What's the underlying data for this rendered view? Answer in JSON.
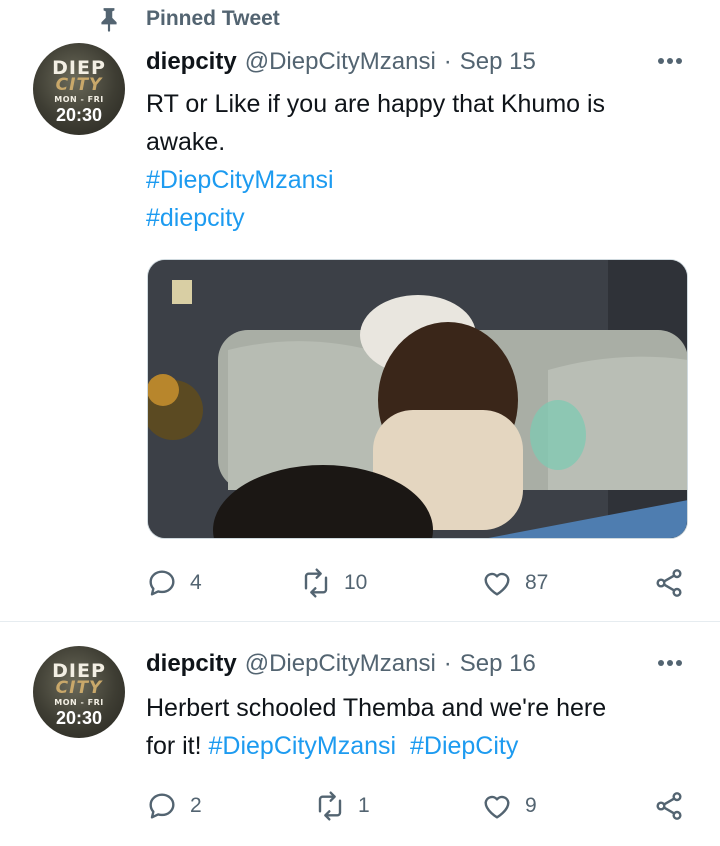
{
  "pinned": {
    "label": "Pinned Tweet",
    "icon": "pin-icon"
  },
  "tweets": [
    {
      "avatar": {
        "line1": "DIEP",
        "line2": "CITY",
        "days": "MON - FRI",
        "time": "20:30"
      },
      "display_name": "diepcity",
      "handle": "@DiepCityMzansi",
      "separator": "·",
      "date": "Sep 15",
      "text_line1": "RT or Like if you are happy that Khumo is",
      "text_line2": "awake.",
      "hashtag1": "#DiepCityMzansi",
      "hashtag2": "#diepcity",
      "replies": "4",
      "retweets": "10",
      "likes": "87"
    },
    {
      "avatar": {
        "line1": "DIEP",
        "line2": "CITY",
        "days": "MON - FRI",
        "time": "20:30"
      },
      "display_name": "diepcity",
      "handle": "@DiepCityMzansi",
      "separator": "·",
      "date": "Sep 16",
      "text_line1": "Herbert schooled Themba and we're here",
      "text_prefix": "for it! ",
      "hashtag1": "#DiepCityMzansi",
      "hashtag2": "#DiepCity",
      "replies": "2",
      "retweets": "1",
      "likes": "9"
    }
  ],
  "colors": {
    "link": "#1d9bf0",
    "secondary": "#536471",
    "primary_text": "#0f1419",
    "divider": "#e6ecf0"
  }
}
